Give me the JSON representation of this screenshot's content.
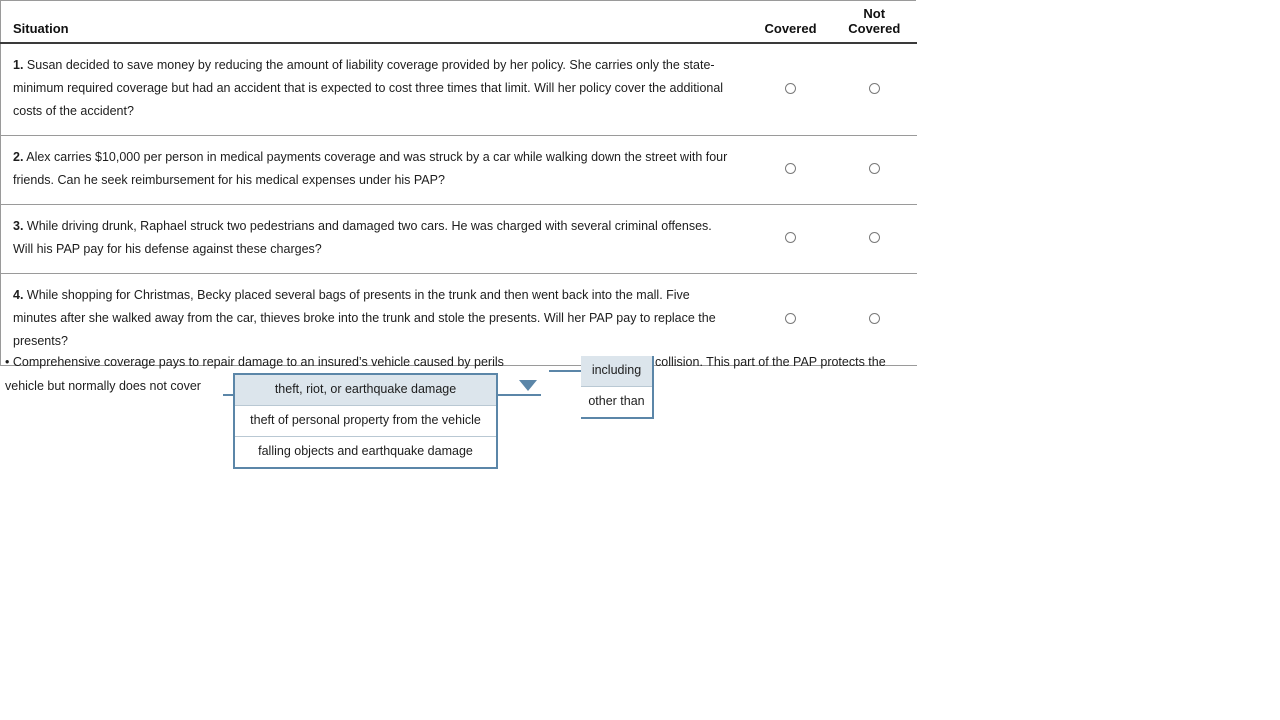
{
  "table": {
    "headers": {
      "situation": "Situation",
      "covered": "Covered",
      "not_covered_line1": "Not",
      "not_covered_line2": "Covered"
    },
    "rows": [
      {
        "number": "1.",
        "text": "Susan decided to save money by reducing the amount of liability coverage provided by her policy. She carries only the state-minimum required coverage but had an accident that is expected to cost three times that limit. Will her policy cover the additional costs of the accident?",
        "covered_selected": false,
        "not_covered_selected": false
      },
      {
        "number": "2.",
        "text": "Alex carries $10,000 per person in medical payments coverage and was struck by a car while walking down the street with four friends. Can he seek reimbursement for his medical expenses under his PAP?",
        "covered_selected": false,
        "not_covered_selected": false
      },
      {
        "number": "3.",
        "text": "While driving drunk, Raphael struck two pedestrians and damaged two cars. He was charged with several criminal offenses. Will his PAP pay for his defense against these charges?",
        "covered_selected": false,
        "not_covered_selected": false
      },
      {
        "number": "4.",
        "text": "While shopping for Christmas, Becky placed several bags of presents in the trunk and then went back into the mall. Five minutes after she walked away from the car, thieves broke into the trunk and stole the presents. Will her PAP pay to replace the presents?",
        "covered_selected": false,
        "not_covered_selected": false
      }
    ]
  },
  "fill_in": {
    "bullet": "•",
    "sentence_part1": "Comprehensive coverage pays to repair damage to an insured’s vehicle caused by perils",
    "sentence_part2": "collision. This part of the PAP protects the",
    "sentence_part3": "vehicle but normally does not cover",
    "dropdown_perils": {
      "selected": "including",
      "options": [
        "including",
        "other than"
      ]
    },
    "dropdown_coverage": {
      "selected": "theft, riot, or earthquake damage",
      "options": [
        "theft, riot, or earthquake damage",
        "theft of personal property from the vehicle",
        "falling objects and earthquake damage"
      ]
    }
  },
  "colors": {
    "accent_blue": "#5b86a8",
    "highlight_bg": "#dce5ec",
    "table_border": "#9a9a9a",
    "text": "#1d1d1d"
  }
}
